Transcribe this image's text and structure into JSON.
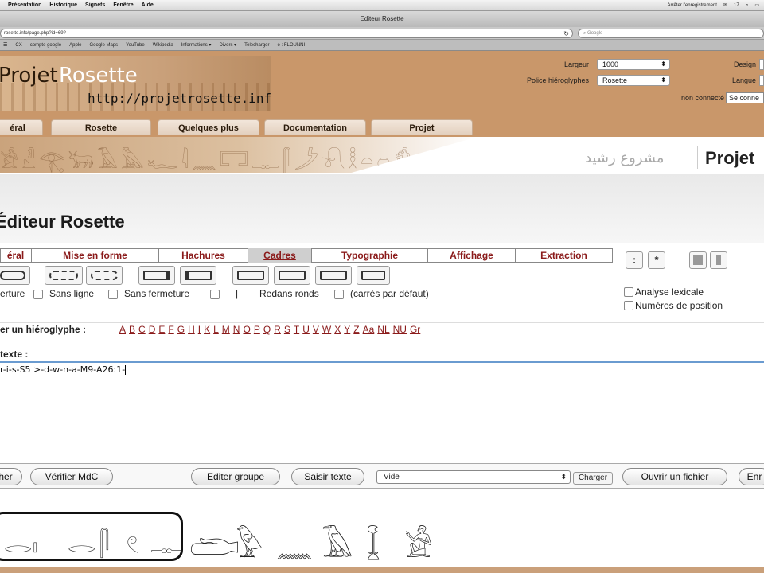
{
  "mac_menu": {
    "items": [
      "Présentation",
      "Historique",
      "Signets",
      "Fenêtre",
      "Aide"
    ],
    "status_text": "Arrêter l'enregistrement",
    "clock": "17"
  },
  "window": {
    "title": "Editeur Rosette"
  },
  "browser": {
    "address": "rosette.info/page.php?id=69?",
    "search_placeholder": "Google",
    "bookmarks": [
      "CX",
      "compte google",
      "Apple",
      "Google Maps",
      "YouTube",
      "Wikipédia",
      "Informations ▾",
      "Divers ▾",
      "Telecharger",
      "e : FLOUNNI"
    ]
  },
  "site": {
    "logo_projet": "Projet",
    "logo_rosette": "Rosette",
    "logo_url": "http://projetrosette.info",
    "largeur_label": "Largeur",
    "largeur_value": "1000",
    "police_label": "Police hiéroglyphes",
    "police_value": "Rosette",
    "design_label": "Design",
    "langue_label": "Langue",
    "status": "non connecté",
    "connect_label": "Se conne",
    "nav_tabs": [
      "éral",
      "Rosette",
      "Quelques plus",
      "Documentation",
      "Projet"
    ],
    "banner_arabic": "مشروع رشيد",
    "banner_projet": "Projet"
  },
  "editor": {
    "title": "Éditeur Rosette",
    "tool_tabs": [
      "éral",
      "Mise en forme",
      "Hachures",
      "Cadres",
      "Typographie",
      "Affichage",
      "Extraction"
    ],
    "active_tab": "Cadres",
    "options": {
      "fermeture": "erture",
      "sans_ligne": "Sans ligne",
      "sans_fermeture": "Sans fermeture",
      "pipe": "|",
      "redans": "Redans ronds",
      "carres": "(carrés par défaut)"
    },
    "sq_buttons": [
      ":",
      "*"
    ],
    "side_checks": [
      "Analyse lexicale",
      "Numéros de position"
    ],
    "letter_label": "er un hiéroglyphe :",
    "letters": [
      "A",
      "B",
      "C",
      "D",
      "E",
      "F",
      "G",
      "H",
      "I",
      "K",
      "L",
      "M",
      "N",
      "O",
      "P",
      "Q",
      "R",
      "S",
      "T",
      "U",
      "V",
      "W",
      "X",
      "Y",
      "Z",
      "Aa",
      "NL",
      "NU",
      "Gr"
    ],
    "texte_label": "texte :",
    "text_value": "r-i-s-S5 >-d-w-n-a-M9-A26:1-",
    "buttons": {
      "b1": "her",
      "verifier": "Vérifier MdC",
      "editer_groupe": "Editer groupe",
      "saisir_texte": "Saisir texte",
      "select_value": "Vide",
      "charger": "Charger",
      "ouvrir": "Ouvrir un fichier",
      "en": "Enr"
    }
  },
  "glyphs": {
    "cartouche": [
      "𓂋",
      "𓏤",
      "𓂋",
      "𓋴",
      "𓏲",
      "𓊃"
    ],
    "outside": [
      "𓂧",
      "𓅱",
      "𓈖",
      "𓄿",
      "𓆼",
      "𓀀"
    ]
  }
}
